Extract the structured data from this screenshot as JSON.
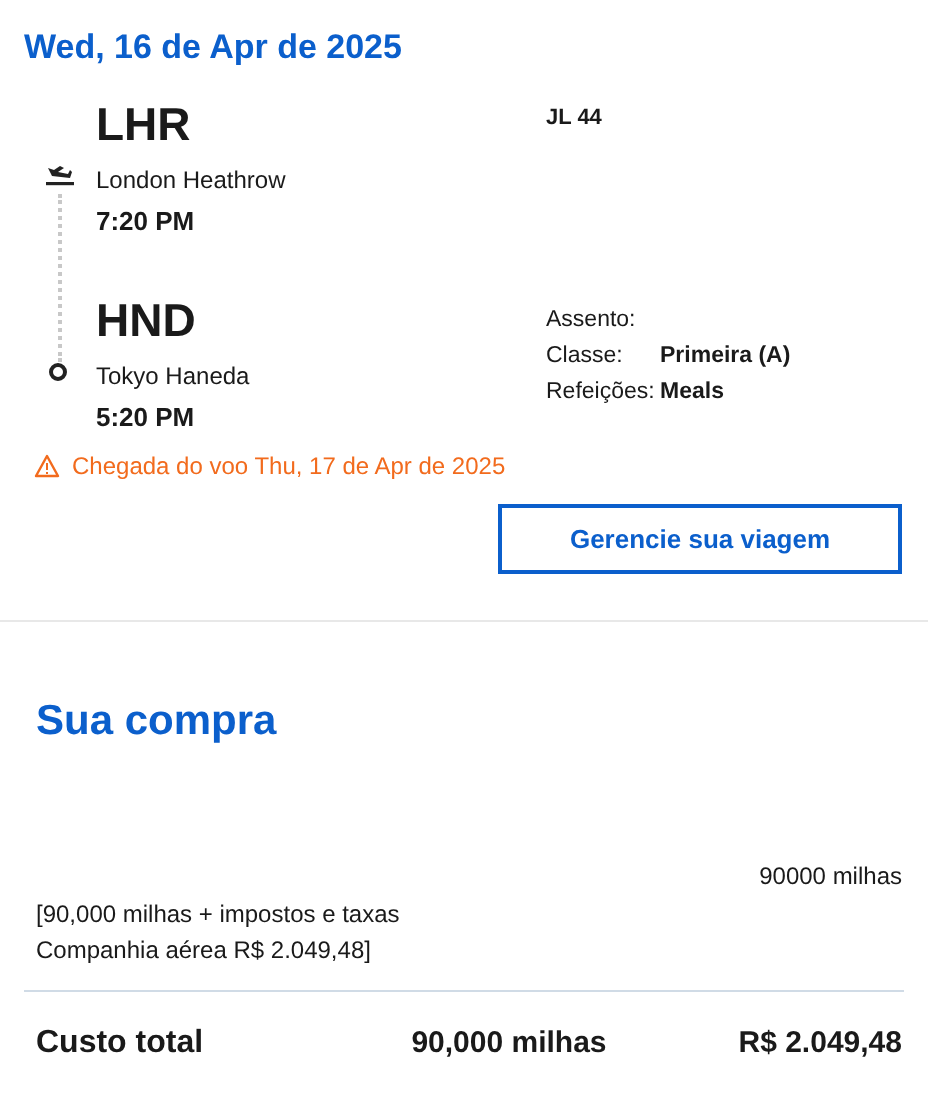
{
  "flight": {
    "date": "Wed, 16 de Apr de 2025",
    "departure": {
      "code": "LHR",
      "airport": "London Heathrow",
      "time": "7:20 PM"
    },
    "arrival": {
      "code": "HND",
      "airport": "Tokyo Haneda",
      "time": "5:20 PM"
    },
    "flight_number": "JL 44",
    "details": [
      {
        "label": "Assento:"
      },
      {
        "label": "Classe:",
        "value": "Primeira (A)"
      },
      {
        "label": "Refeições:",
        "value": "Meals"
      }
    ],
    "warning": "Chegada do voo Thu, 17 de Apr de 2025",
    "manage_button": "Gerencie sua viagem"
  },
  "purchase": {
    "title": "Sua compra",
    "miles": "90000 milhas",
    "breakdown": [
      "[90,000 milhas + impostos e taxas",
      "Companhia aérea R$ 2.049,48]"
    ],
    "total": {
      "label": "Custo total",
      "miles": "90,000 milhas",
      "price": "R$ 2.049,48"
    }
  }
}
